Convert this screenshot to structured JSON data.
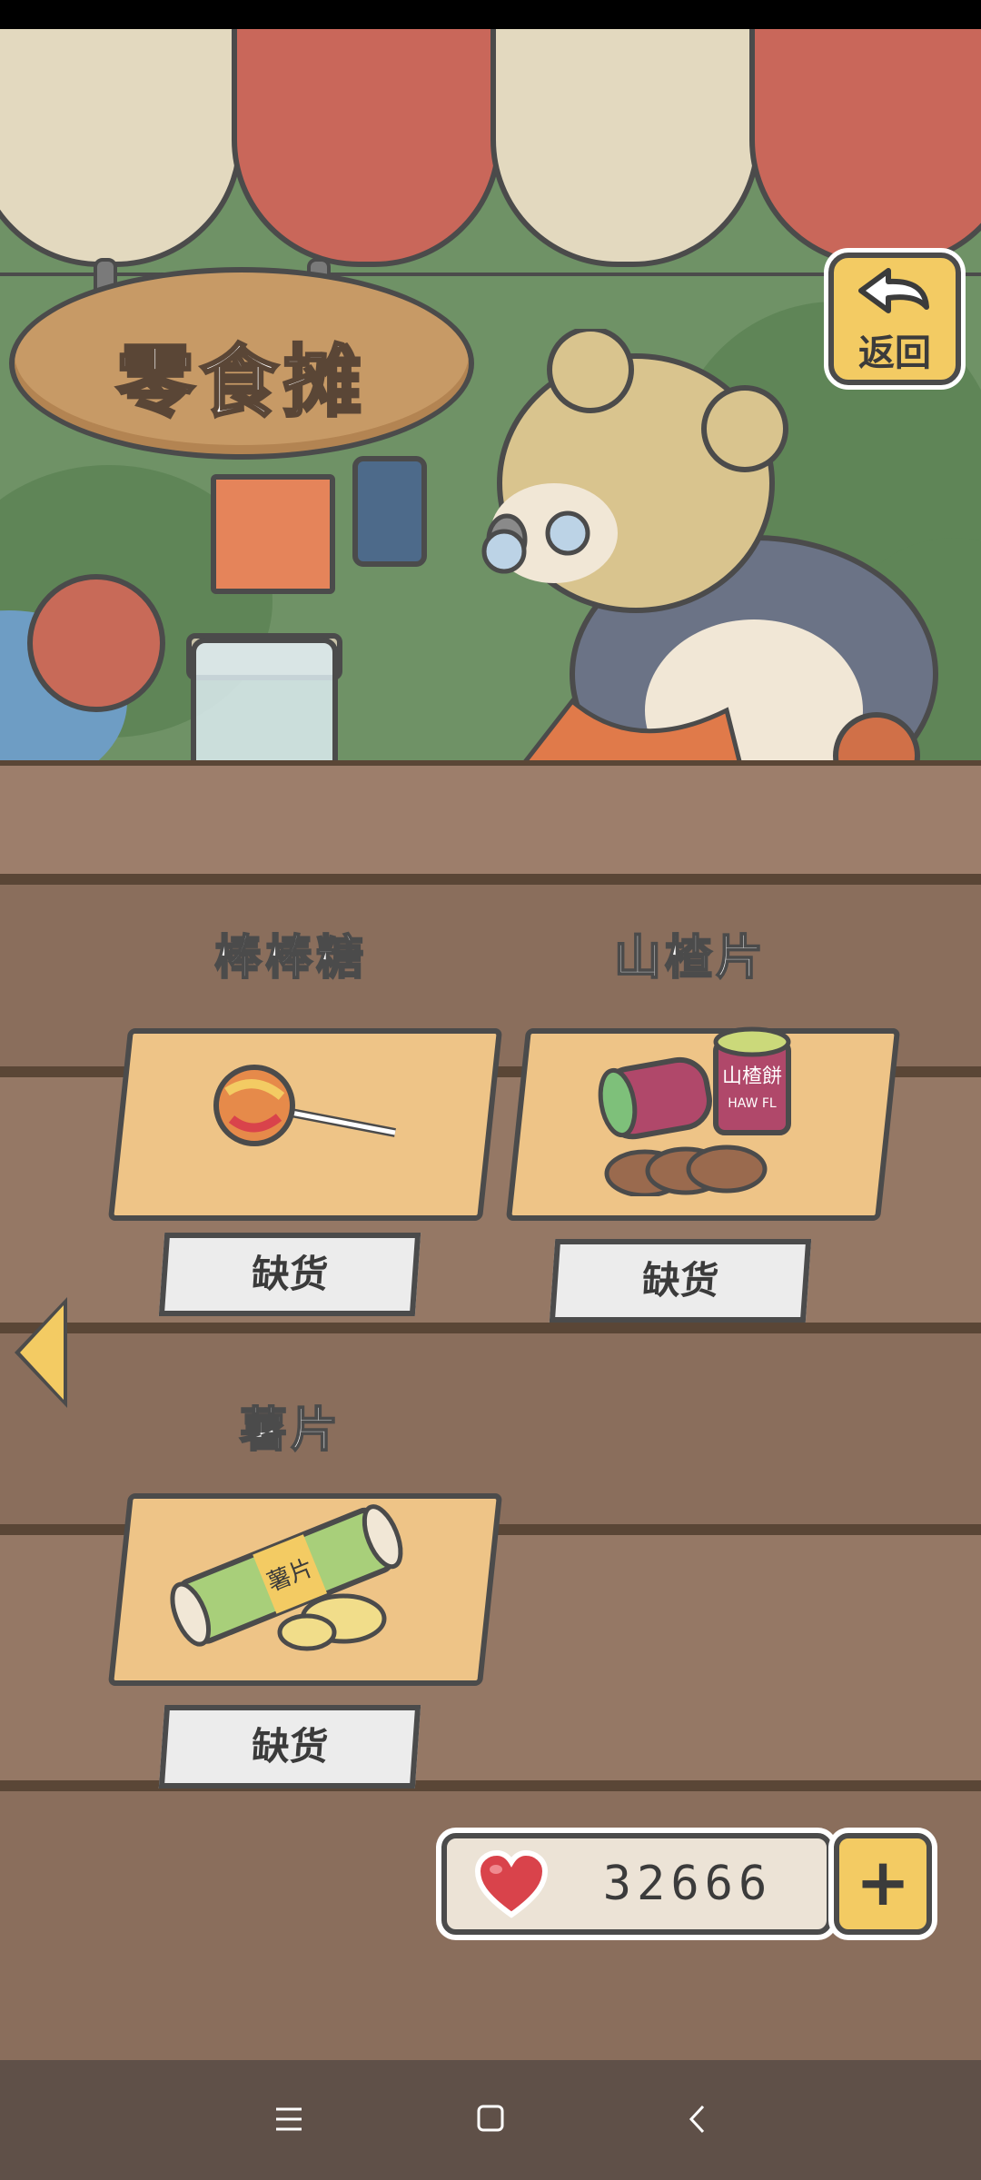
{
  "stall": {
    "title": "零食摊",
    "back_label": "返回"
  },
  "items": [
    {
      "name": "棒棒糖",
      "status": "缺货",
      "icon": "lollipop-icon"
    },
    {
      "name": "山楂片",
      "status": "缺货",
      "icon": "hawthorn-flakes-icon"
    },
    {
      "name": "薯片",
      "status": "缺货",
      "icon": "potato-chips-icon"
    }
  ],
  "can_labels": {
    "hawthorn_can_text": "山楂餅",
    "hawthorn_can_sub": "HAW FL",
    "chips_can_text": "薯片"
  },
  "currency": {
    "icon": "heart-icon",
    "value": "32666",
    "add_label": "+"
  },
  "colors": {
    "accent_yellow": "#f3cb63",
    "card": "#eec487",
    "outline": "#4b4b4b",
    "heart": "#d9434b"
  }
}
